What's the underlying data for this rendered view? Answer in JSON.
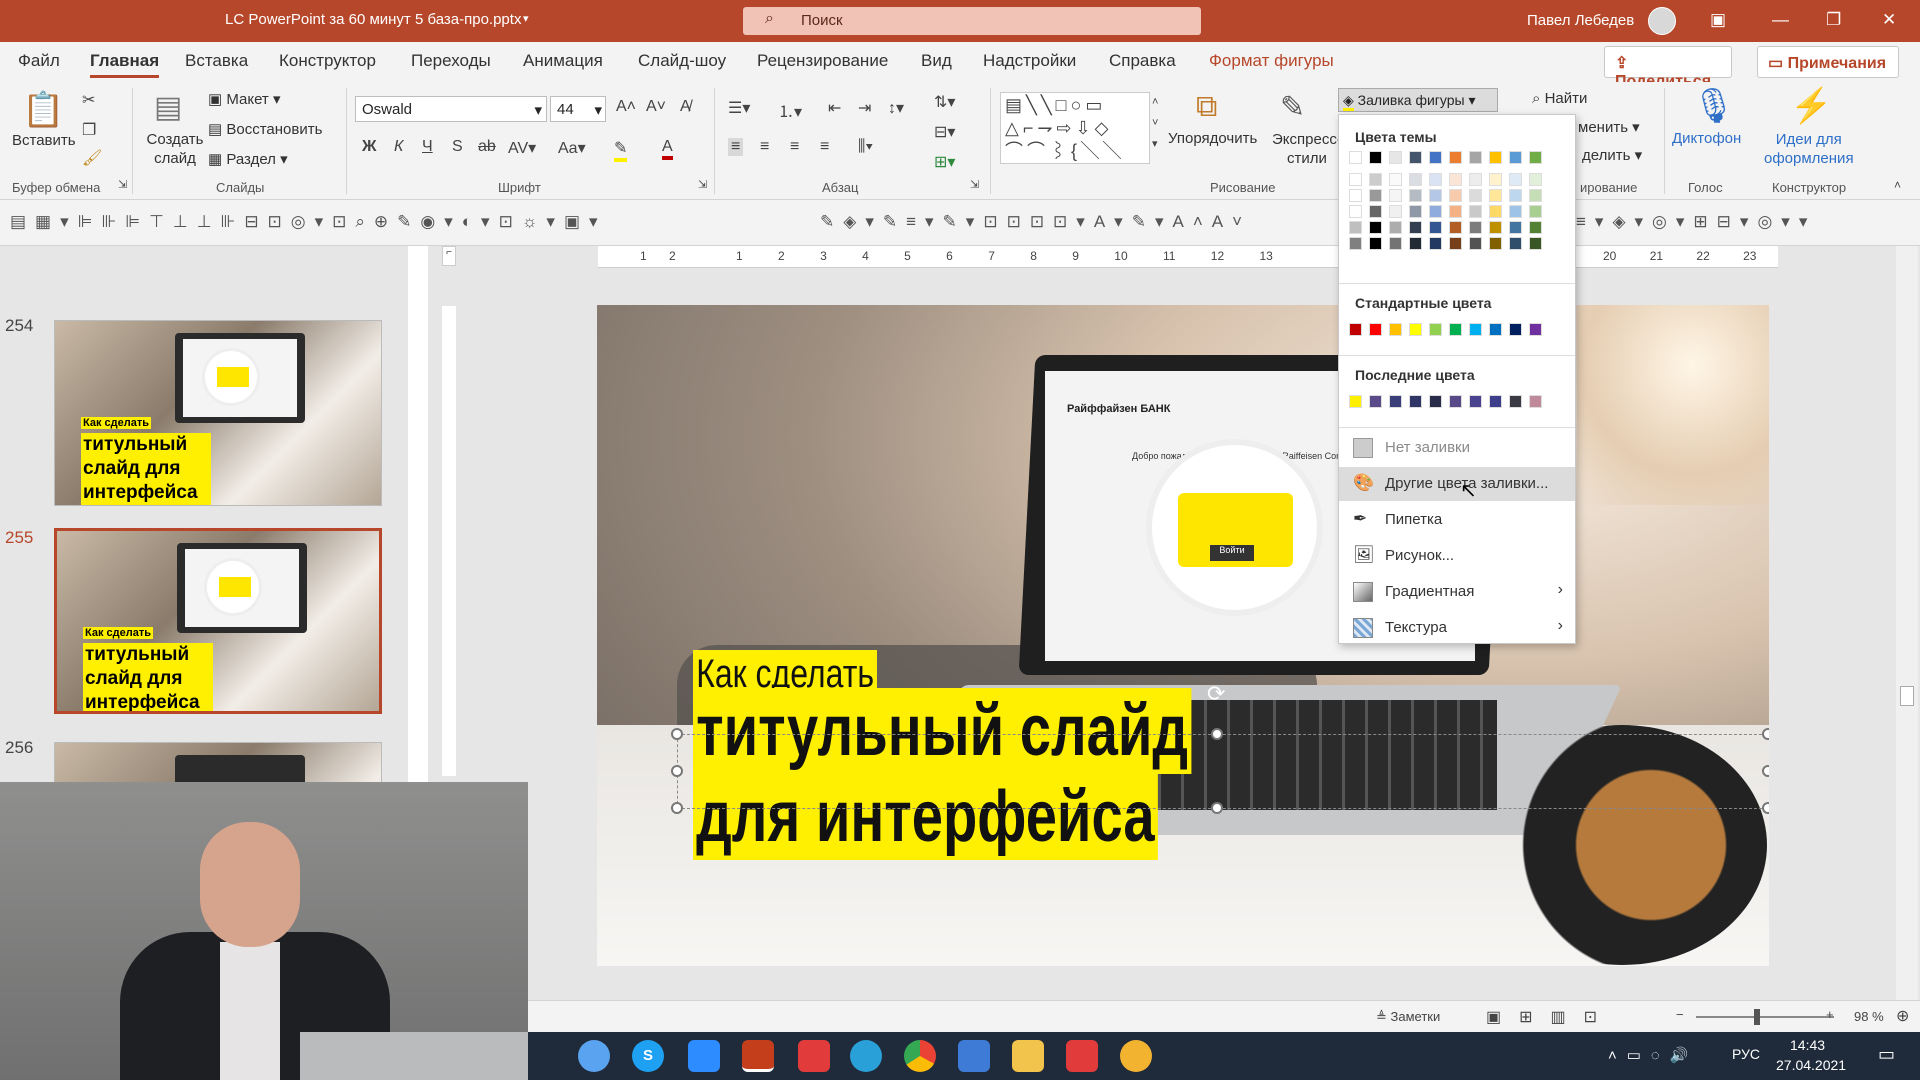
{
  "titlebar": {
    "doc": "LC PowerPoint за 60 минут 5 база-про.pptx",
    "search": "Поиск",
    "user": "Павел Лебедев",
    "min": "—",
    "restore": "❐",
    "close": "✕",
    "ribbon_opt": "▣"
  },
  "tabs": [
    "Файл",
    "Главная",
    "Вставка",
    "Конструктор",
    "Переходы",
    "Анимация",
    "Слайд-шоу",
    "Рецензирование",
    "Вид",
    "Надстройки",
    "Справка",
    "Формат фигуры"
  ],
  "share": "Поделиться",
  "comments": "Примечания",
  "ribbon": {
    "paste": "Вставить",
    "new_slide": "Создать\nслайд",
    "layout": "Макет",
    "reset": "Восстановить",
    "section": "Раздел",
    "font_name": "Oswald",
    "font_size": "44",
    "bold": "Ж",
    "italic": "К",
    "underline": "Ч",
    "shadow": "S",
    "strike": "ab",
    "arrange": "Упорядочить",
    "quick_styles": "Экспресс-\nстили",
    "fill_button": "Заливка фигуры",
    "find": "Найти",
    "replace": "менить",
    "select": "делить",
    "dictate": "Диктофон",
    "designer": "Идеи для\nоформления",
    "groups": {
      "clipboard": "Буфер обмена",
      "slides": "Слайды",
      "font": "Шрифт",
      "paragraph": "Абзац",
      "drawing": "Рисование",
      "editing": "ирование",
      "voice": "Голос",
      "designer": "Конструктор"
    }
  },
  "ruler_numbers": [
    "1",
    "2",
    "1",
    "2",
    "3",
    "4",
    "5",
    "6",
    "7",
    "8",
    "9",
    "10",
    "11",
    "12",
    "13",
    "14",
    "20",
    "21",
    "22",
    "23"
  ],
  "thumbnails": [
    {
      "num": "254",
      "t1": "Как сделать",
      "t2": "титульный слайд для интерфейса"
    },
    {
      "num": "255",
      "t1": "Как сделать",
      "t2": "титульный слайд для интерфейса"
    },
    {
      "num": "256"
    }
  ],
  "slide": {
    "small": "Как сделать",
    "line1": "титульный слайд",
    "line2": "для интерфейса",
    "bank": "Райффайзен БАНК",
    "welcome": "Добро пожаловать в интернет-банк Raiffeisen Connect!",
    "login_btn": "Войти"
  },
  "menu": {
    "theme_header": "Цвета темы",
    "standard_header": "Стандартные цвета",
    "recent_header": "Последние цвета",
    "theme_top": [
      "#ffffff",
      "#000000",
      "#e7e6e6",
      "#44546a",
      "#4472c4",
      "#ed7d31",
      "#a5a5a5",
      "#ffc000",
      "#5b9bd5",
      "#70ad47"
    ],
    "standard": [
      "#c00000",
      "#ff0000",
      "#ffc000",
      "#ffff00",
      "#92d050",
      "#00b050",
      "#00b0f0",
      "#0070c0",
      "#002060",
      "#7030a0"
    ],
    "recent": [
      "#ffef00",
      "#5a4a8a",
      "#3a3f7a",
      "#2f3566",
      "#2a2d4a",
      "#584a88",
      "#4a4490",
      "#3e3f8a",
      "#3a3a44",
      "#c08a9a"
    ],
    "no_fill": "Нет заливки",
    "more_colors": "Другие цвета заливки...",
    "eyedropper": "Пипетка",
    "picture": "Рисунок...",
    "gradient": "Градиентная",
    "texture": "Текстура"
  },
  "status": {
    "notes": "Заметки",
    "zoom": "98 %"
  },
  "tray": {
    "lang": "РУС",
    "time": "14:43",
    "date": "27.04.2021"
  }
}
